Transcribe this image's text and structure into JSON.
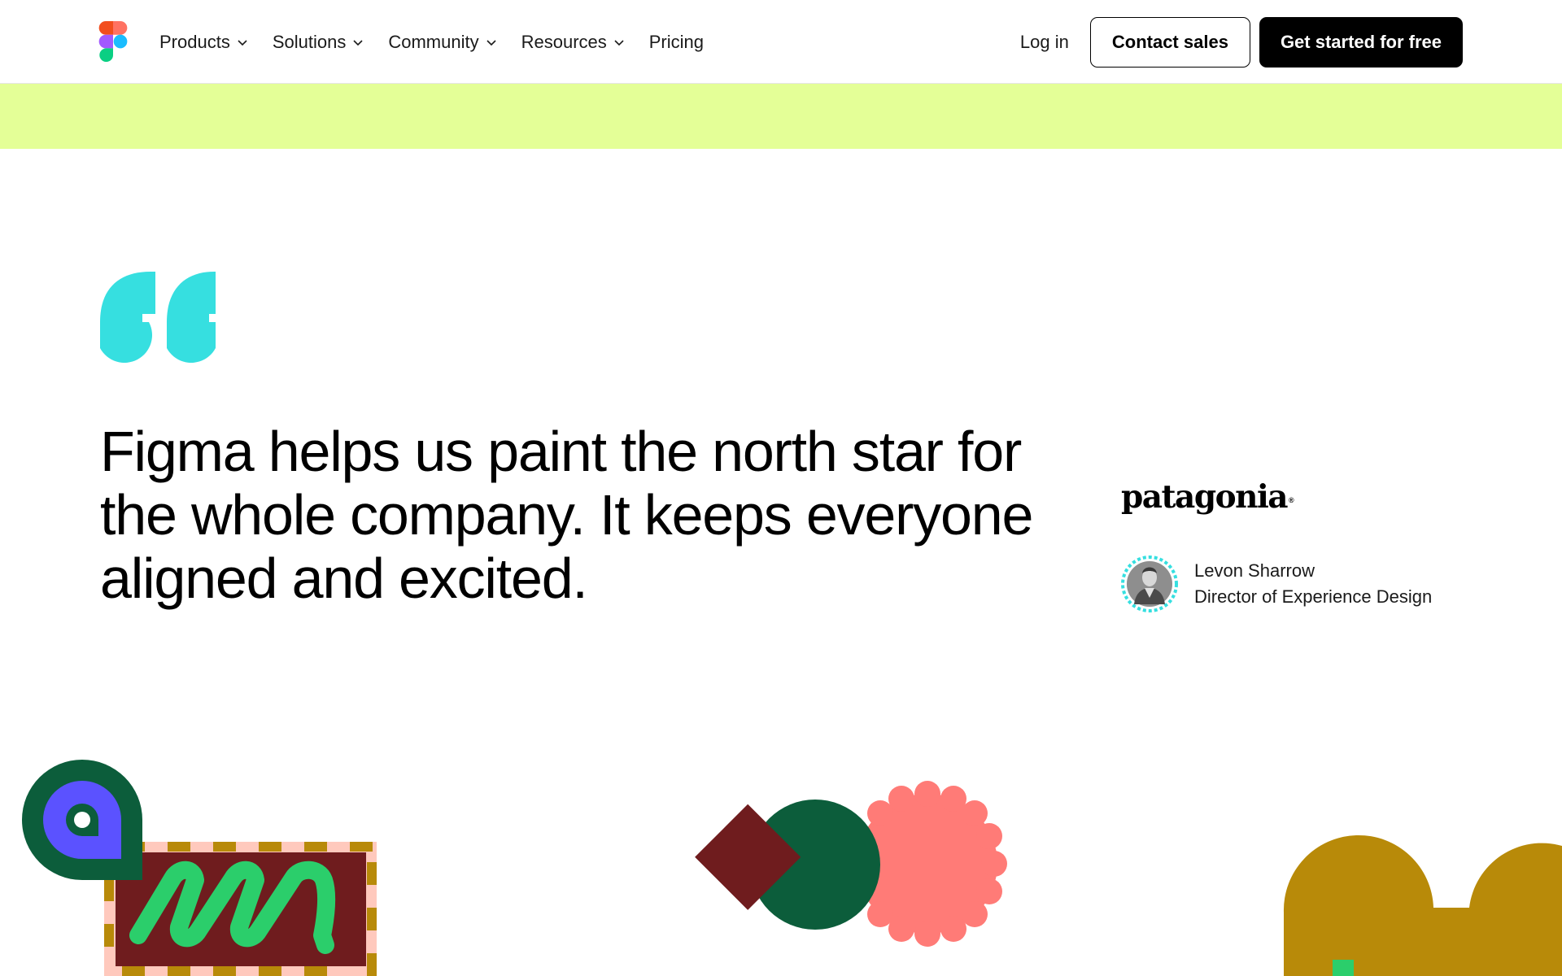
{
  "header": {
    "logo_icon": "figma-logo-icon",
    "nav": [
      {
        "label": "Products",
        "has_dropdown": true
      },
      {
        "label": "Solutions",
        "has_dropdown": true
      },
      {
        "label": "Community",
        "has_dropdown": true
      },
      {
        "label": "Resources",
        "has_dropdown": true
      },
      {
        "label": "Pricing",
        "has_dropdown": false
      }
    ],
    "login_label": "Log in",
    "contact_label": "Contact sales",
    "cta_label": "Get started for free"
  },
  "banner": {
    "color": "#e4ff97"
  },
  "testimonial": {
    "quote_icon": "quote-mark-icon",
    "quote_color": "#36dfe0",
    "quote_lines": [
      "Figma helps us paint the north star for",
      "the whole company. It keeps everyone",
      "aligned and excited."
    ],
    "company": "patagonia",
    "company_mark": "®",
    "person_name": "Levon Sharrow",
    "person_title": "Director of Experience Design"
  },
  "colors": {
    "accent_cyan": "#36dfe0",
    "dark_green": "#0c5d3b",
    "maroon": "#6f1c1e",
    "coral": "#ff7b77",
    "bright_green": "#2bce6b",
    "blue_violet": "#5b52ff",
    "ochre": "#b88a09",
    "pink": "#ffc9bd"
  }
}
